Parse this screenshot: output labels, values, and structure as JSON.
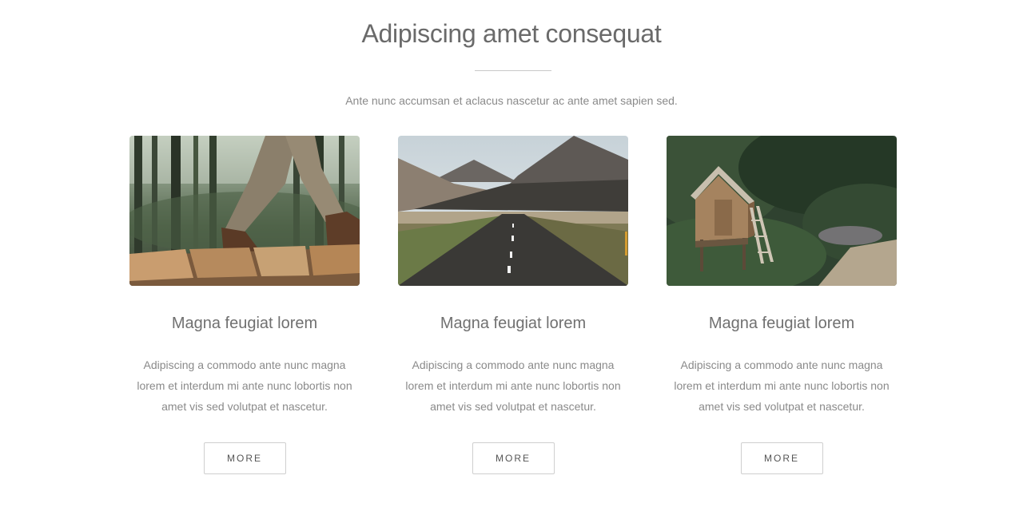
{
  "section": {
    "title": "Adipiscing amet consequat",
    "lead": "Ante nunc accumsan et aclacus nascetur ac ante amet sapien sed."
  },
  "cards": [
    {
      "image": "hiker-boardwalk-forest-photo",
      "title": "Magna feugiat lorem",
      "text": "Adipiscing a commodo ante nunc magna lorem et interdum mi ante nunc lobortis non amet vis sed volutpat et nascetur.",
      "button": "MORE"
    },
    {
      "image": "mountain-road-photo",
      "title": "Magna feugiat lorem",
      "text": "Adipiscing a commodo ante nunc magna lorem et interdum mi ante nunc lobortis non amet vis sed volutpat et nascetur.",
      "button": "MORE"
    },
    {
      "image": "wooden-hut-forest-photo",
      "title": "Magna feugiat lorem",
      "text": "Adipiscing a commodo ante nunc magna lorem et interdum mi ante nunc lobortis non amet vis sed volutpat et nascetur.",
      "button": "MORE"
    }
  ],
  "colors": {
    "heading": "#6a6a6a",
    "body_text": "#8a8a8a",
    "divider": "#c9c9c9",
    "button_border": "#cfcfcf"
  }
}
